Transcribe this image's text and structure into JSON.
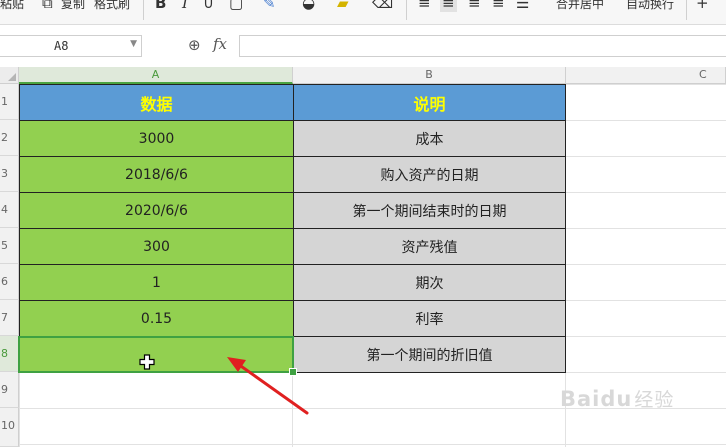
{
  "ribbon": {
    "paste_label": "粘贴",
    "copy_label": "复制",
    "format_painter_label": "格式刷",
    "bold": "B",
    "italic": "I",
    "merge_center_label": "合并居中",
    "wrap_text_label": "自动换行"
  },
  "formula_bar": {
    "cell_reference": "A8",
    "fx_label": "fx",
    "formula": ""
  },
  "columns": [
    "A",
    "B",
    "C"
  ],
  "rows": [
    "1",
    "2",
    "3",
    "4",
    "5",
    "6",
    "7",
    "8",
    "9",
    "10"
  ],
  "table": {
    "header": {
      "data": "数据",
      "desc": "说明"
    },
    "rows": [
      {
        "data": "3000",
        "desc": "成本"
      },
      {
        "data": "2018/6/6",
        "desc": "购入资产的日期"
      },
      {
        "data": "2020/6/6",
        "desc": "第一个期间结束时的日期"
      },
      {
        "data": "300",
        "desc": "资产残值"
      },
      {
        "data": "1",
        "desc": "期次"
      },
      {
        "data": "0.15",
        "desc": "利率"
      },
      {
        "data": "",
        "desc": "第一个期间的折旧值"
      }
    ]
  },
  "selected_cell": "A8",
  "watermark": {
    "brand": "Baidu",
    "suffix": "经验"
  },
  "colors": {
    "header_fill": "#5b9bd5",
    "header_text": "#ffff00",
    "data_fill": "#92d050",
    "desc_fill": "#d5d5d5",
    "selection": "#3fa142",
    "arrow": "#e02020"
  }
}
